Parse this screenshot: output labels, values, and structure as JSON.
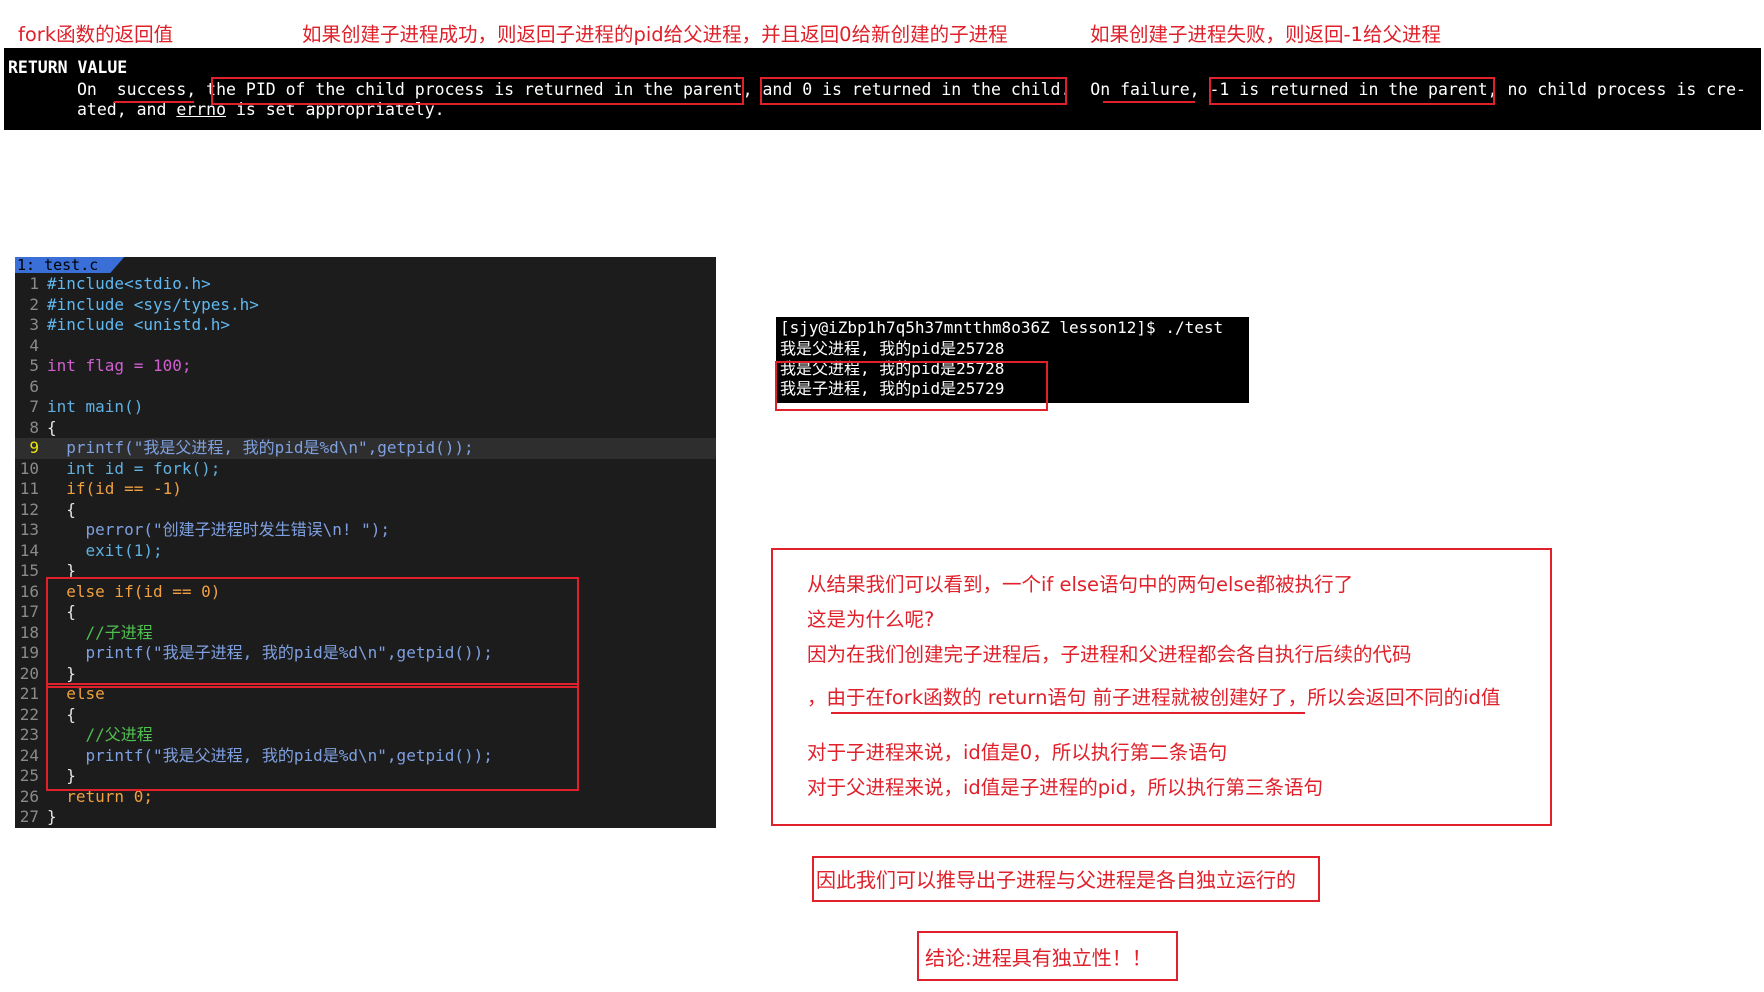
{
  "top_labels": {
    "fork_return": "fork函数的返回值",
    "success_note": "如果创建子进程成功，则返回子进程的pid给父进程，并且返回0给新创建的子进程",
    "failure_note": "如果创建子进程失败，则返回-1给父进程"
  },
  "manpage": {
    "heading": "RETURN VALUE",
    "line1": {
      "lead": "On ",
      "success": " success,",
      "gap1": " ",
      "pid_parent": "the PID of the child process is returned in the parent",
      "comma": ",",
      "zero_child": "and 0 is returned in the child.",
      "on_failure": "  On failure,",
      "neg_one": "-1 is returned in the parent",
      "tail": ", no child process is cre-"
    },
    "line2": {
      "lead": "ated, and ",
      "errno": "errno",
      "tail": " is set appropriately."
    }
  },
  "editor": {
    "tab_label": "1: test.c",
    "lines": [
      {
        "n": "1",
        "code": "#include<stdio.h>"
      },
      {
        "n": "2",
        "code": "#include <sys/types.h>"
      },
      {
        "n": "3",
        "code": "#include <unistd.h>"
      },
      {
        "n": "4",
        "code": ""
      },
      {
        "n": "5",
        "code": "int flag = 100;"
      },
      {
        "n": "6",
        "code": ""
      },
      {
        "n": "7",
        "code": "int main()"
      },
      {
        "n": "8",
        "code": "{"
      },
      {
        "n": "9",
        "code": "  printf(\"我是父进程, 我的pid是%d\\n\",getpid());"
      },
      {
        "n": "10",
        "code": "  int id = fork();"
      },
      {
        "n": "11",
        "code": "  if(id == -1)"
      },
      {
        "n": "12",
        "code": "  {"
      },
      {
        "n": "13",
        "code": "    perror(\"创建子进程时发生错误\\n! \");"
      },
      {
        "n": "14",
        "code": "    exit(1);"
      },
      {
        "n": "15",
        "code": "  }"
      },
      {
        "n": "16",
        "code": "  else if(id == 0)"
      },
      {
        "n": "17",
        "code": "  {"
      },
      {
        "n": "18",
        "code": "    //子进程"
      },
      {
        "n": "19",
        "code": "    printf(\"我是子进程, 我的pid是%d\\n\",getpid());"
      },
      {
        "n": "20",
        "code": "  }"
      },
      {
        "n": "21",
        "code": "  else"
      },
      {
        "n": "22",
        "code": "  {"
      },
      {
        "n": "23",
        "code": "    //父进程"
      },
      {
        "n": "24",
        "code": "    printf(\"我是父进程, 我的pid是%d\\n\",getpid());"
      },
      {
        "n": "25",
        "code": "  }"
      },
      {
        "n": "26",
        "code": "  return 0;"
      },
      {
        "n": "27",
        "code": "}"
      }
    ]
  },
  "terminal": {
    "prompt": "[sjy@iZbp1h7q5h37mntthm8o36Z lesson12]$ ./test",
    "out1": "我是父进程, 我的pid是25728",
    "out2": "我是父进程, 我的pid是25728",
    "out3": "我是子进程, 我的pid是25729"
  },
  "explanation": {
    "line1": "从结果我们可以看到，一个if else语句中的两句else都被执行了",
    "line2": "这是为什么呢?",
    "line3": "因为在我们创建完子进程后，子进程和父进程都会各自执行后续的代码",
    "line4": "，由于在fork函数的 return语句 前子进程就被创建好了，所以会返回不同的id值",
    "line5": "对于子进程来说，id值是0，所以执行第二条语句",
    "line6": "对于父进程来说，id值是子进程的pid，所以执行第三条语句"
  },
  "inference": "因此我们可以推导出子进程与父进程是各自独立运行的",
  "conclusion": "结论:进程具有独立性！！",
  "colors": {
    "annotation_red": "#e0202a",
    "terminal_bg": "#000000",
    "editor_bg": "#1c1c1c",
    "tab_blue": "#3a6fd8"
  }
}
